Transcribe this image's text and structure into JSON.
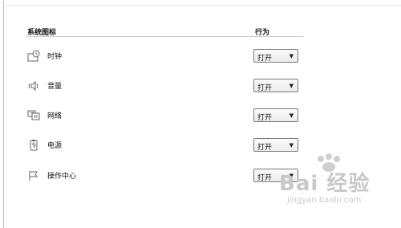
{
  "header": {
    "icons_col": "系统图标",
    "behavior_col": "行为"
  },
  "rows": [
    {
      "label": "时钟",
      "icon": "clock-icon",
      "value": "打开"
    },
    {
      "label": "音量",
      "icon": "volume-icon",
      "value": "打开"
    },
    {
      "label": "网络",
      "icon": "network-icon",
      "value": "打开"
    },
    {
      "label": "电源",
      "icon": "power-icon",
      "value": "打开"
    },
    {
      "label": "操作中心",
      "icon": "flag-icon",
      "value": "打开"
    }
  ],
  "watermark": {
    "text": "Bai 经验",
    "url": "jingyan.baidu.com"
  }
}
